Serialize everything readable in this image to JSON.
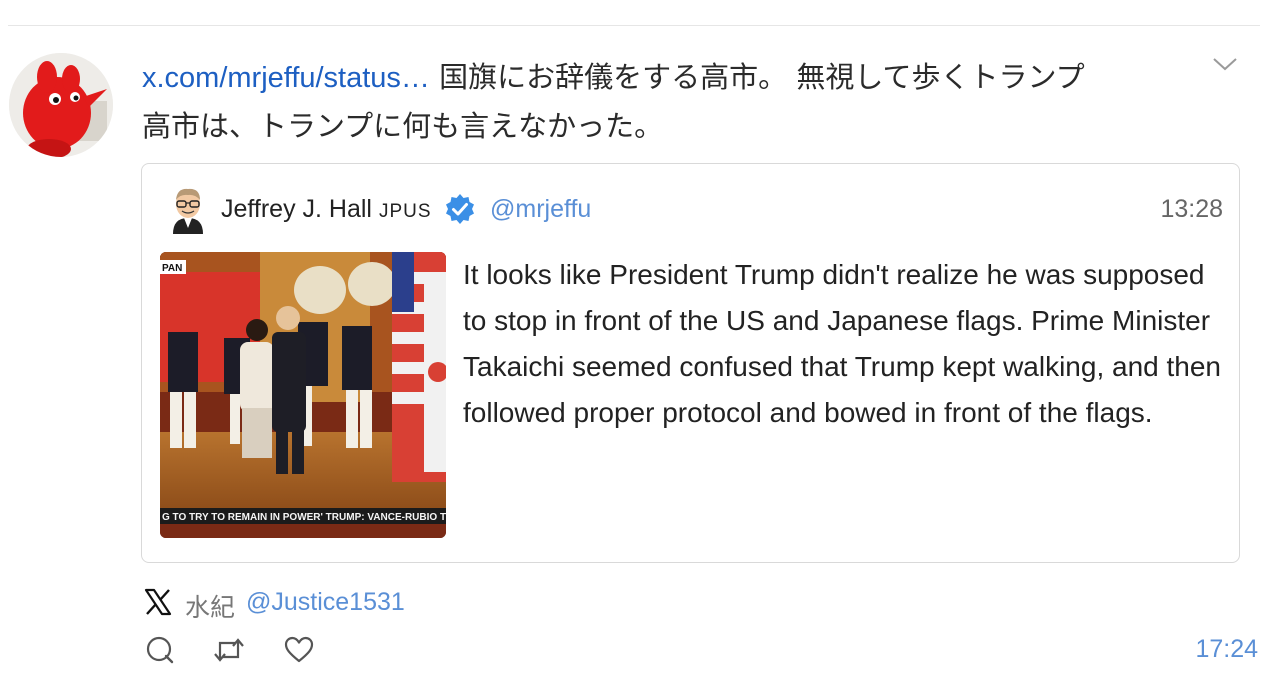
{
  "post": {
    "link": "x.com/mrjeffu/status…",
    "text_line1": " 国旗にお辞儀をする高市。 無視して歩くトランプ",
    "text_line2": "高市は、トランプに何も言えなかった。"
  },
  "quote": {
    "name": "Jeffrey J. Hall",
    "name_suffix": "JPUS",
    "handle": "@mrjeffu",
    "time": "13:28",
    "text": "It looks like President Trump didn't realize he was supposed to stop in front of the US and Japanese flags. Prime Minister Takaichi seemed confused that Trump kept walking, and then followed proper protocol and bowed in front of the flags.",
    "image_caption_top": "PAN",
    "image_ticker": "G TO TRY TO REMAIN IN POWER'    TRUMP: VANCE-RUBIO TIC"
  },
  "source": {
    "name": "水紀",
    "handle": "@Justice1531"
  },
  "footer": {
    "time": "17:24"
  },
  "icons": [
    "x-logo-icon",
    "reply-icon",
    "retweet-icon",
    "like-icon",
    "verified-badge-icon",
    "chevron-down-icon"
  ],
  "colors": {
    "link": "#1d5fc2",
    "handle": "#5a8fd6",
    "verified": "#3b8fe6"
  }
}
